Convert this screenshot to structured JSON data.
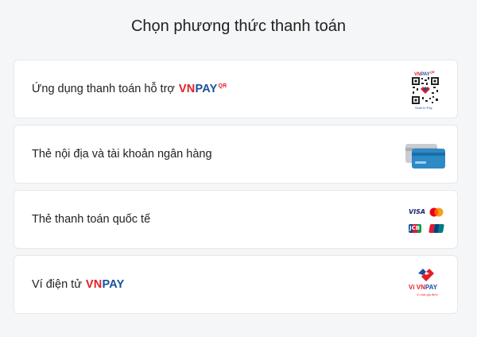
{
  "page": {
    "title": "Chọn phương thức thanh toán"
  },
  "colors": {
    "vn_red": "#e41e26",
    "pay_blue": "#1a4f9c",
    "card_blue": "#2d8ac7"
  },
  "methods": [
    {
      "label": "Ứng dụng thanh toán hỗ trợ",
      "brand_vn": "VN",
      "brand_pay": "PAY",
      "brand_sup": "QR",
      "icon": "vnpay-qr-logo",
      "logo_text_vn": "VN",
      "logo_text_pay": "PAY",
      "logo_sup": "QR",
      "logo_caption": "Scan to Pay"
    },
    {
      "label": "Thẻ nội địa và tài khoản ngân hàng",
      "icon": "bank-card-icon"
    },
    {
      "label": "Thẻ thanh toán quốc tế",
      "icon": "international-cards-icon",
      "cards": [
        "VISA",
        "JCB"
      ]
    },
    {
      "label": "Ví điện tử",
      "brand_vn": "VN",
      "brand_pay": "PAY",
      "icon": "vnpay-wallet-logo",
      "logo_text_vi": "Ví ",
      "logo_text_vn": "VN",
      "logo_text_pay": "PAY",
      "logo_caption": "Ví của gia đình"
    }
  ]
}
